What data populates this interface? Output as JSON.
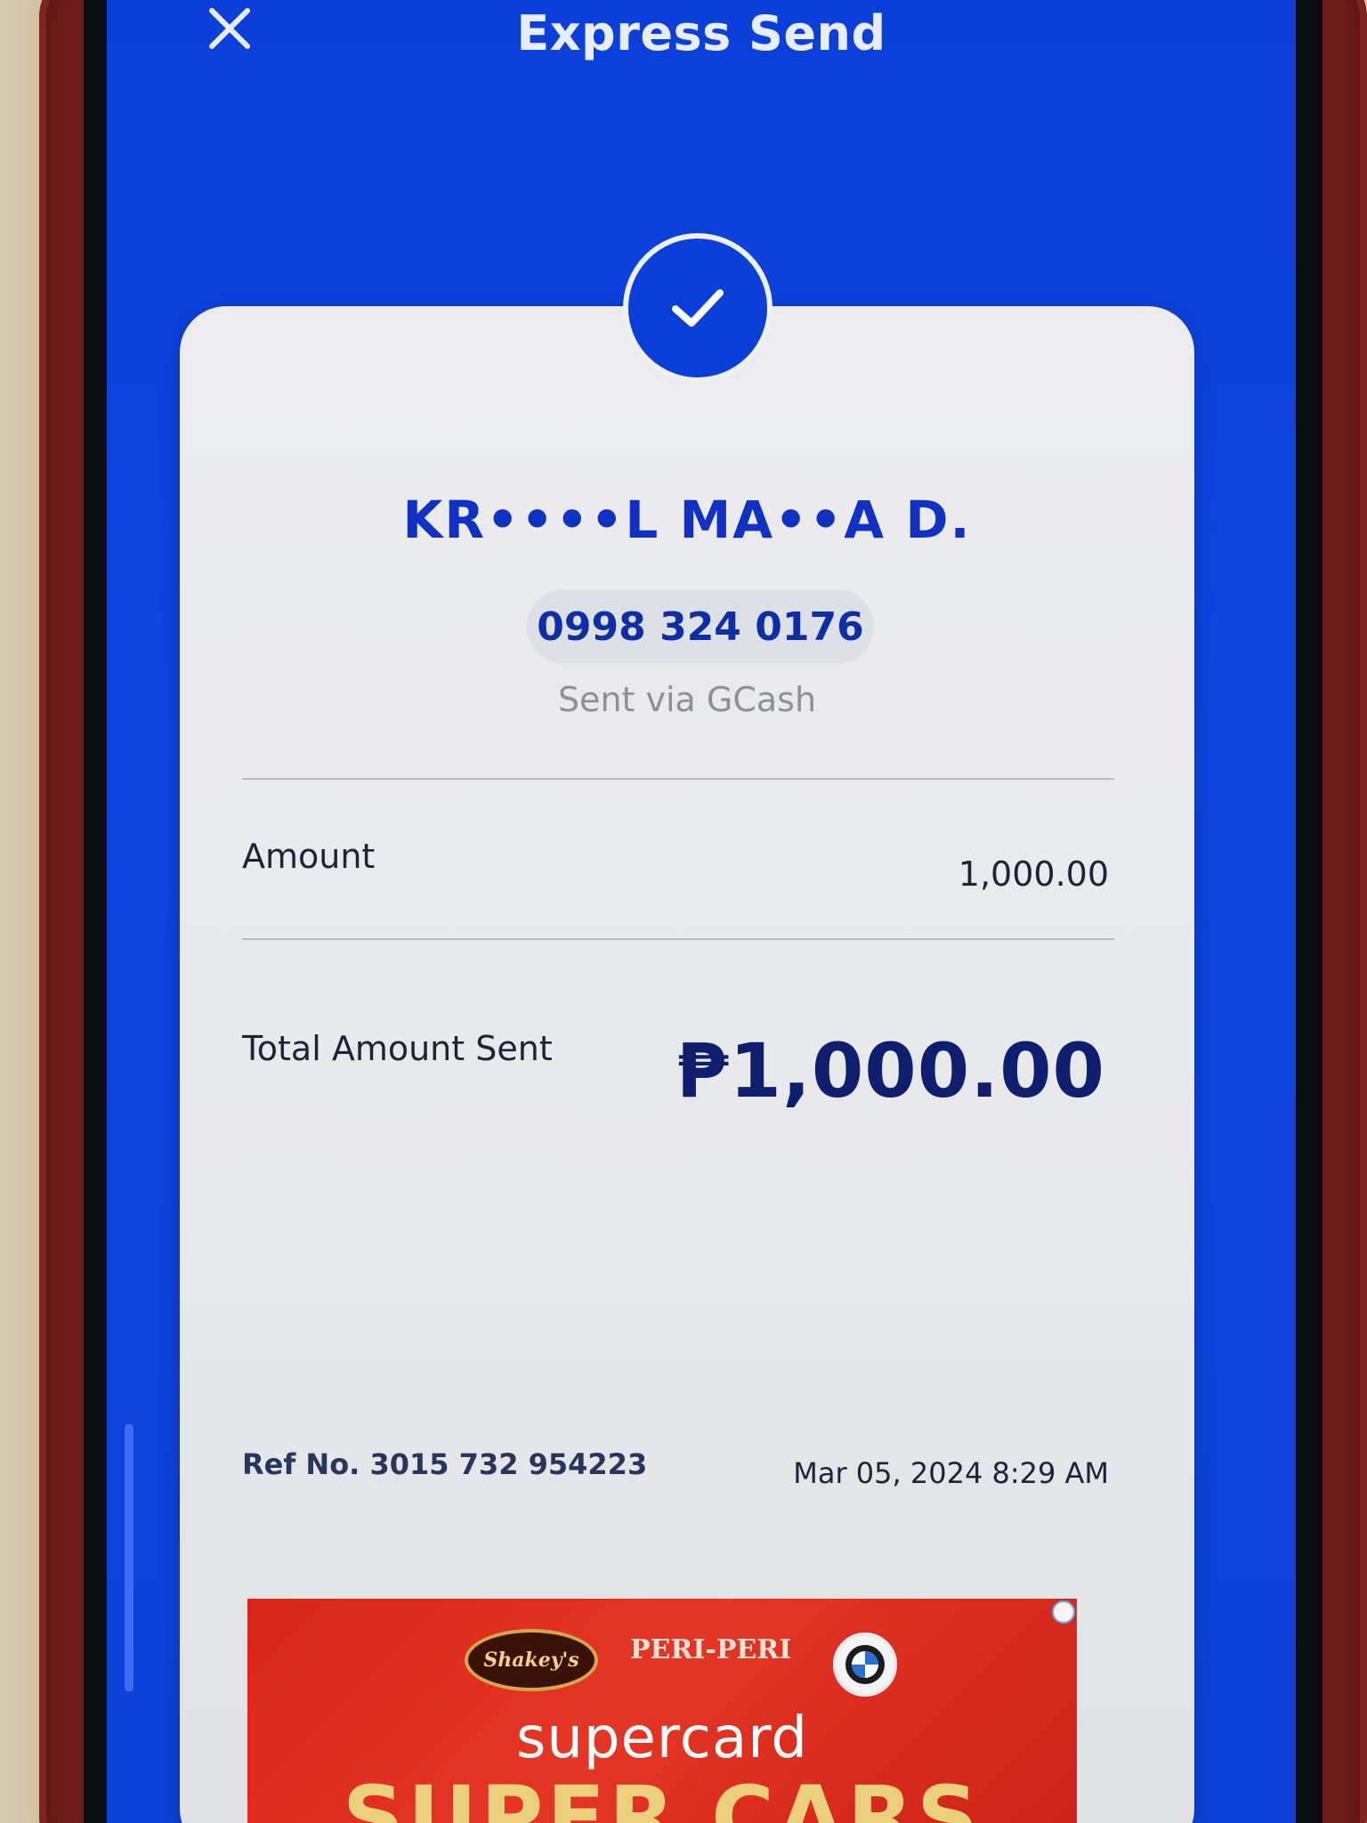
{
  "header": {
    "title": "Express Send",
    "close_icon": "close-icon"
  },
  "receipt": {
    "status_icon": "checkmark-icon",
    "recipient_name": "KR••••L MA••A D.",
    "phone_number": "0998 324 0176",
    "sent_via": "Sent via GCash",
    "amount_label": "Amount",
    "amount_value": "1,000.00",
    "total_label": "Total Amount Sent",
    "total_value": "₱1,000.00",
    "ref_no": "Ref No. 3015 732 954223",
    "date_time": "Mar 05, 2024 8:29 AM"
  },
  "promo": {
    "logo_1": "Shakey's",
    "logo_2": "PERI-PERI",
    "brand": "supercard",
    "headline": "SUPER CARS"
  },
  "colors": {
    "primary_blue": "#0b3fd9",
    "card_bg": "#ececee",
    "name_blue": "#1032c4",
    "total_navy": "#0f1e6e",
    "promo_red": "#d8261c"
  }
}
